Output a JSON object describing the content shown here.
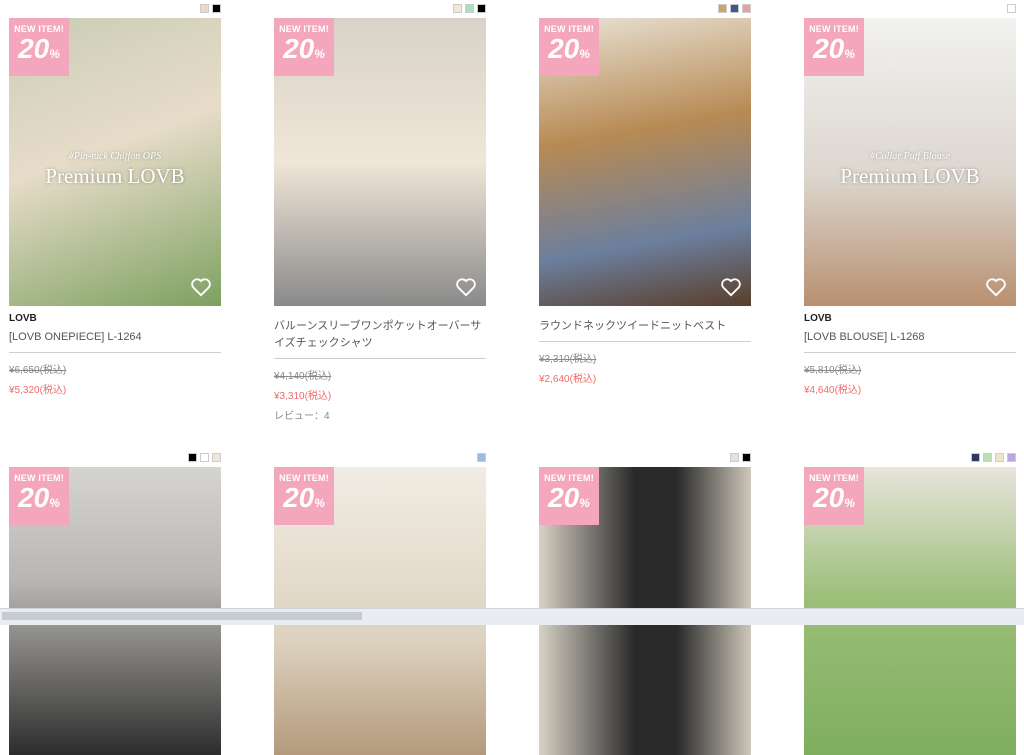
{
  "badge": {
    "new": "NEW ITEM!",
    "pct": "20",
    "pct_sign": "%"
  },
  "products": [
    {
      "swatches": [
        "#e9dcc0",
        "#000000"
      ],
      "photo_bg": "linear-gradient(160deg,#c9cdb6 0%,#e7dcc9 45%,#7da160 100%)",
      "has_premium": true,
      "premium_sub": "#Pin-tuck Chiffon OPS",
      "premium_main": "Premium LOVB",
      "brand": "LOVB",
      "name": "[LOVB ONEPIECE] L-1264",
      "old_price": "¥6,650(税込)",
      "new_price": "¥5,320(税込)",
      "review": ""
    },
    {
      "swatches": [
        "#f3e6d6",
        "#a9dfc1",
        "#000000"
      ],
      "photo_bg": "linear-gradient(180deg,#d8d2c8 0%,#f0e6d8 50%,#8a8a8a 100%)",
      "has_premium": false,
      "premium_sub": "",
      "premium_main": "",
      "brand": "",
      "name": "バルーンスリーブワンポケットオーバーサイズチェックシャツ",
      "old_price": "¥4,140(税込)",
      "new_price": "¥3,310(税込)",
      "review": "レビュー：4"
    },
    {
      "swatches": [
        "#c9a66b",
        "#3b5a8c",
        "#e8a0a7"
      ],
      "photo_bg": "linear-gradient(170deg,#e9e3d6 0%,#b78a54 40%,#6c7f9e 75%,#5a3e2a 100%)",
      "has_premium": false,
      "premium_sub": "",
      "premium_main": "",
      "brand": "",
      "name": "ラウンドネックツイードニットベスト",
      "old_price": "¥3,310(税込)",
      "new_price": "¥2,640(税込)",
      "review": ""
    },
    {
      "swatches": [
        "#ffffff"
      ],
      "photo_bg": "linear-gradient(180deg,#f2f2f0 0%,#dcd6ce 55%,#b89070 100%)",
      "has_premium": true,
      "premium_sub": "#Collar Puff Blouse",
      "premium_main": "Premium LOVB",
      "brand": "LOVB",
      "name": "[LOVB BLOUSE] L-1268",
      "old_price": "¥5,810(税込)",
      "new_price": "¥4,640(税込)",
      "review": ""
    },
    {
      "swatches": [
        "#000000",
        "#ffffff",
        "#efe6da"
      ],
      "photo_bg": "linear-gradient(180deg,#d6d4d0 0%,#b8b6b2 40%,#2d2d2d 100%)",
      "has_premium": false
    },
    {
      "swatches": [
        "#9bbbe0"
      ],
      "photo_bg": "linear-gradient(180deg,#f1ece3 0%,#ddd2c0 60%,#b49a7c 100%)",
      "has_premium": false
    },
    {
      "swatches": [
        "#e6e1d8",
        "#000000"
      ],
      "photo_bg": "linear-gradient(90deg,#d8d2c6 0%,#2a2a2a 45%,#2a2a2a 65%,#cfc8ba 100%)",
      "has_premium": false
    },
    {
      "swatches": [
        "#2b3a5e",
        "#b8e0b0",
        "#efe6c8",
        "#b9a8e0"
      ],
      "photo_bg": "linear-gradient(180deg,#e9e4dc 0%,#9cbf7a 45%,#7fae5e 100%)",
      "has_premium": false
    }
  ]
}
